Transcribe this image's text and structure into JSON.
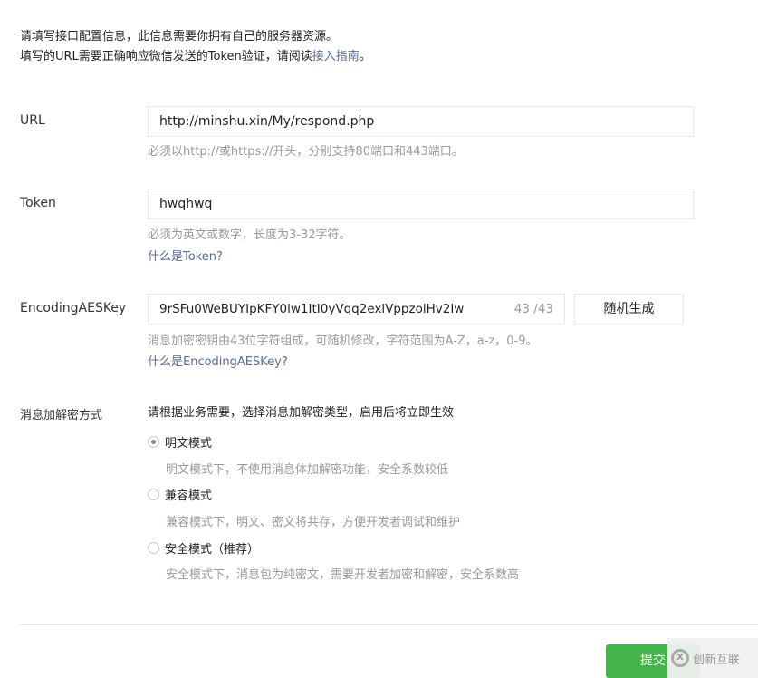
{
  "intro": {
    "line1": "请填写接口配置信息，此信息需要你拥有自己的服务器资源。",
    "line2_prefix": "填写的URL需要正确响应微信发送的Token验证，请阅读",
    "line2_link": "接入指南",
    "line2_suffix": "。"
  },
  "url": {
    "label": "URL",
    "value": "http://minshu.xin/My/respond.php",
    "tip": "必须以http://或https://开头，分别支持80端口和443端口。"
  },
  "token": {
    "label": "Token",
    "value": "hwqhwq",
    "tip": "必须为英文或数字，长度为3-32字符。",
    "link": "什么是Token?"
  },
  "aes": {
    "label": "EncodingAESKey",
    "value": "9rSFu0WeBUYIpKFY0lw1ItI0yVqq2exlVppzolHv2Iw",
    "counter": "43 /43",
    "button": "随机生成",
    "tip": "消息加密密钥由43位字符组成，可随机修改，字符范围为A-Z，a-z，0-9。",
    "link": "什么是EncodingAESKey?"
  },
  "mode": {
    "label": "消息加解密方式",
    "desc": "请根据业务需要，选择消息加解密类型，启用后将立即生效",
    "options": [
      {
        "label": "明文模式",
        "desc": "明文模式下，不使用消息体加解密功能，安全系数较低",
        "selected": true
      },
      {
        "label": "兼容模式",
        "desc": "兼容模式下，明文、密文将共存，方便开发者调试和维护",
        "selected": false
      },
      {
        "label": "安全模式（推荐）",
        "desc": "安全模式下，消息包为纯密文，需要开发者加密和解密，安全系数高",
        "selected": false
      }
    ]
  },
  "submit": "提交",
  "watermark": "创新互联",
  "colors": {
    "primary": "#44b549",
    "link": "#576b95"
  }
}
